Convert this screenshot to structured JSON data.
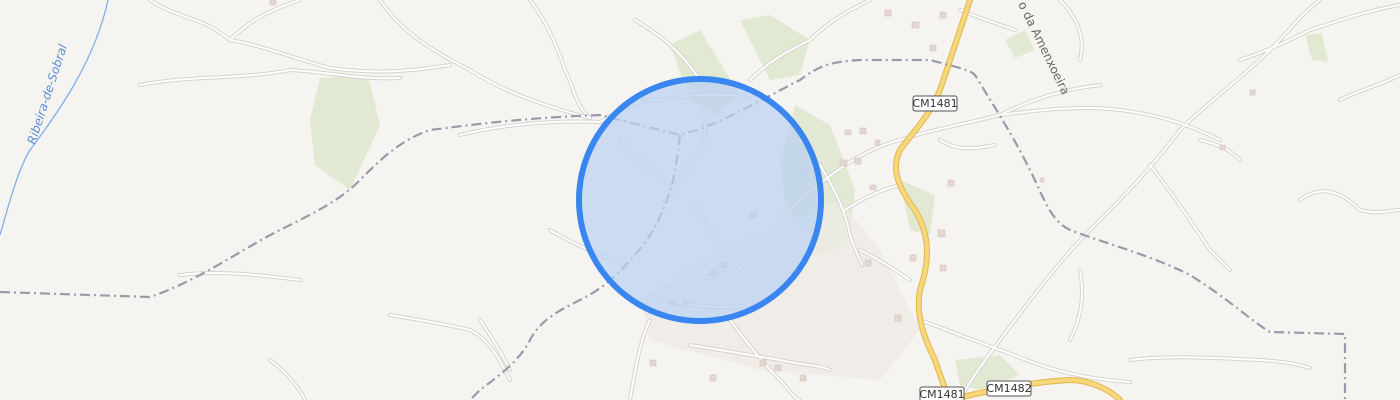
{
  "map": {
    "labels": {
      "stream": "Ribeira-de-Sobral",
      "street": "o da Amenxoeira",
      "road_cm1481_top": "CM1481",
      "road_cm1481_bottom": "CM1481",
      "road_cm1482": "CM1482"
    },
    "colors": {
      "background": "#f6f4f1",
      "minor_road": "#ffffff",
      "minor_road_casing": "#d6d3cf",
      "main_road": "#f7d77c",
      "main_road_casing": "#e0b84f",
      "boundary": "#9c9aa8",
      "water": "#7fb0e8",
      "green_area": "#dfe8cf",
      "selection_fill": "#b9d1f3",
      "selection_stroke": "#3a86f0",
      "building": "#e4d6d0"
    },
    "selection": {
      "shape": "circle"
    }
  }
}
